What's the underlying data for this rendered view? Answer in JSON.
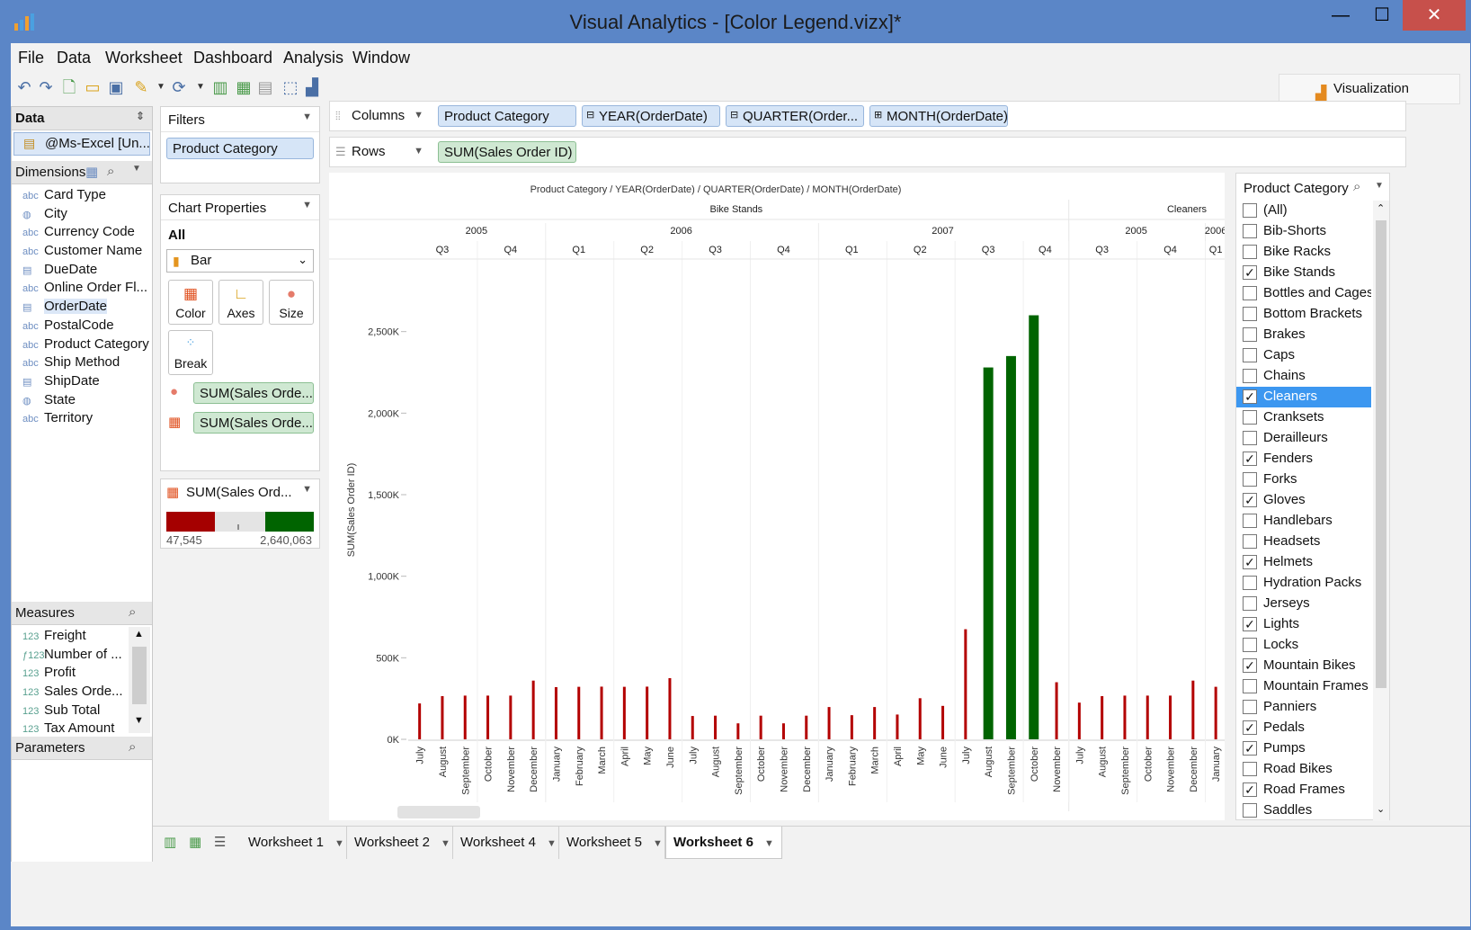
{
  "window": {
    "title": "Visual Analytics - [Color Legend.vizx]*",
    "min": "—",
    "max": "☐",
    "close": "✕"
  },
  "menu": [
    "File",
    "Data",
    "Worksheet",
    "Dashboard",
    "Analysis",
    "Window"
  ],
  "toolbar": {
    "visualization_label": "Visualization"
  },
  "data_panel": {
    "title": "Data",
    "datasource": "@Ms-Excel [Un...",
    "dimensions_title": "Dimensions",
    "dimensions": [
      {
        "type": "abc",
        "name": "Card Type"
      },
      {
        "type": "geo",
        "name": "City"
      },
      {
        "type": "abc",
        "name": "Currency Code"
      },
      {
        "type": "abc",
        "name": "Customer Name"
      },
      {
        "type": "date",
        "name": "DueDate"
      },
      {
        "type": "abc",
        "name": "Online Order Fl..."
      },
      {
        "type": "date",
        "name": "OrderDate"
      },
      {
        "type": "abc",
        "name": "PostalCode"
      },
      {
        "type": "abc",
        "name": "Product Category"
      },
      {
        "type": "abc",
        "name": "Ship Method"
      },
      {
        "type": "date",
        "name": "ShipDate"
      },
      {
        "type": "geo",
        "name": "State"
      },
      {
        "type": "abc",
        "name": "Territory"
      }
    ],
    "measures_title": "Measures",
    "measures": [
      {
        "type": "123",
        "name": "Freight"
      },
      {
        "type": "f123",
        "name": "Number of ..."
      },
      {
        "type": "123",
        "name": "Profit"
      },
      {
        "type": "123",
        "name": "Sales Orde..."
      },
      {
        "type": "123",
        "name": "Sub Total"
      },
      {
        "type": "123",
        "name": "Tax Amount"
      }
    ],
    "parameters_title": "Parameters"
  },
  "filters": {
    "title": "Filters",
    "items": [
      "Product Category"
    ]
  },
  "chart_properties": {
    "title": "Chart Properties",
    "scope": "All",
    "mark_type": "Bar",
    "buttons": [
      "Color",
      "Axes",
      "Size",
      "Break"
    ],
    "pills": [
      "SUM(Sales Orde...",
      "SUM(Sales Orde..."
    ]
  },
  "legend": {
    "title": "SUM(Sales Ord...",
    "min_label": "47,545",
    "max_label": "2,640,063",
    "min_color": "#a50000",
    "max_color": "#006400"
  },
  "shelves": {
    "columns_label": "Columns",
    "columns": [
      "Product Category",
      "YEAR(OrderDate)",
      "QUARTER(Order...",
      "MONTH(OrderDate)"
    ],
    "rows_label": "Rows",
    "rows": [
      "SUM(Sales Order ID)"
    ]
  },
  "chart_data": {
    "type": "bar",
    "title": "Product Category / YEAR(OrderDate) / QUARTER(OrderDate) / MONTH(OrderDate)",
    "ylabel": "SUM(Sales Order ID)",
    "ylim": [
      0,
      2700000
    ],
    "yticks": [
      0,
      500000,
      1000000,
      1500000,
      2000000,
      2500000
    ],
    "ytick_labels": [
      "0K",
      "500K",
      "1,000K",
      "1,500K",
      "2,000K",
      "2,500K"
    ],
    "categories_level": [
      "Bike Stands",
      "Cleaners"
    ],
    "years": [
      {
        "label": "2005",
        "category": 0
      },
      {
        "label": "2006",
        "category": 0
      },
      {
        "label": "2007",
        "category": 0
      },
      {
        "label": "2005",
        "category": 1
      },
      {
        "label": "2006",
        "category": 1
      }
    ],
    "quarters": [
      "Q3",
      "Q4",
      "Q1",
      "Q2",
      "Q3",
      "Q4",
      "Q1",
      "Q2",
      "Q3",
      "Q4",
      "Q3",
      "Q4",
      "Q1"
    ],
    "months": [
      "July",
      "August",
      "September",
      "October",
      "November",
      "December",
      "January",
      "February",
      "March",
      "April",
      "May",
      "June",
      "July",
      "August",
      "September",
      "October",
      "November",
      "December",
      "January",
      "February",
      "March",
      "April",
      "May",
      "June",
      "July",
      "August",
      "September",
      "October",
      "November",
      "July",
      "August",
      "September",
      "October",
      "November",
      "December",
      "January"
    ],
    "values": [
      220000,
      265000,
      268000,
      268000,
      268000,
      360000,
      320000,
      322000,
      323000,
      322000,
      323000,
      375000,
      143000,
      145000,
      98000,
      145000,
      98000,
      145000,
      198000,
      148000,
      198000,
      152000,
      252000,
      205000,
      675000,
      2280000,
      2350000,
      2600000,
      350000,
      225000,
      265000,
      268000,
      268000,
      268000,
      360000,
      322000
    ],
    "low_color": "#b30000",
    "high_color": "#006400"
  },
  "filter_card": {
    "title": "Product Category",
    "items": [
      {
        "label": "(All)",
        "checked": false
      },
      {
        "label": "Bib-Shorts",
        "checked": false
      },
      {
        "label": "Bike Racks",
        "checked": false
      },
      {
        "label": "Bike Stands",
        "checked": true
      },
      {
        "label": "Bottles and Cages",
        "checked": false
      },
      {
        "label": "Bottom Brackets",
        "checked": false
      },
      {
        "label": "Brakes",
        "checked": false
      },
      {
        "label": "Caps",
        "checked": false
      },
      {
        "label": "Chains",
        "checked": false
      },
      {
        "label": "Cleaners",
        "checked": true,
        "selected": true
      },
      {
        "label": "Cranksets",
        "checked": false
      },
      {
        "label": "Derailleurs",
        "checked": false
      },
      {
        "label": "Fenders",
        "checked": true
      },
      {
        "label": "Forks",
        "checked": false
      },
      {
        "label": "Gloves",
        "checked": true
      },
      {
        "label": "Handlebars",
        "checked": false
      },
      {
        "label": "Headsets",
        "checked": false
      },
      {
        "label": "Helmets",
        "checked": true
      },
      {
        "label": "Hydration Packs",
        "checked": false
      },
      {
        "label": "Jerseys",
        "checked": false
      },
      {
        "label": "Lights",
        "checked": true
      },
      {
        "label": "Locks",
        "checked": false
      },
      {
        "label": "Mountain Bikes",
        "checked": true
      },
      {
        "label": "Mountain Frames",
        "checked": false
      },
      {
        "label": "Panniers",
        "checked": false
      },
      {
        "label": "Pedals",
        "checked": true
      },
      {
        "label": "Pumps",
        "checked": true
      },
      {
        "label": "Road Bikes",
        "checked": false
      },
      {
        "label": "Road Frames",
        "checked": true
      },
      {
        "label": "Saddles",
        "checked": false
      }
    ]
  },
  "sheet_tabs": [
    {
      "label": "Worksheet 1",
      "active": false
    },
    {
      "label": "Worksheet 2",
      "active": false
    },
    {
      "label": "Worksheet 4",
      "active": false
    },
    {
      "label": "Worksheet 5",
      "active": false
    },
    {
      "label": "Worksheet 6",
      "active": true
    }
  ]
}
